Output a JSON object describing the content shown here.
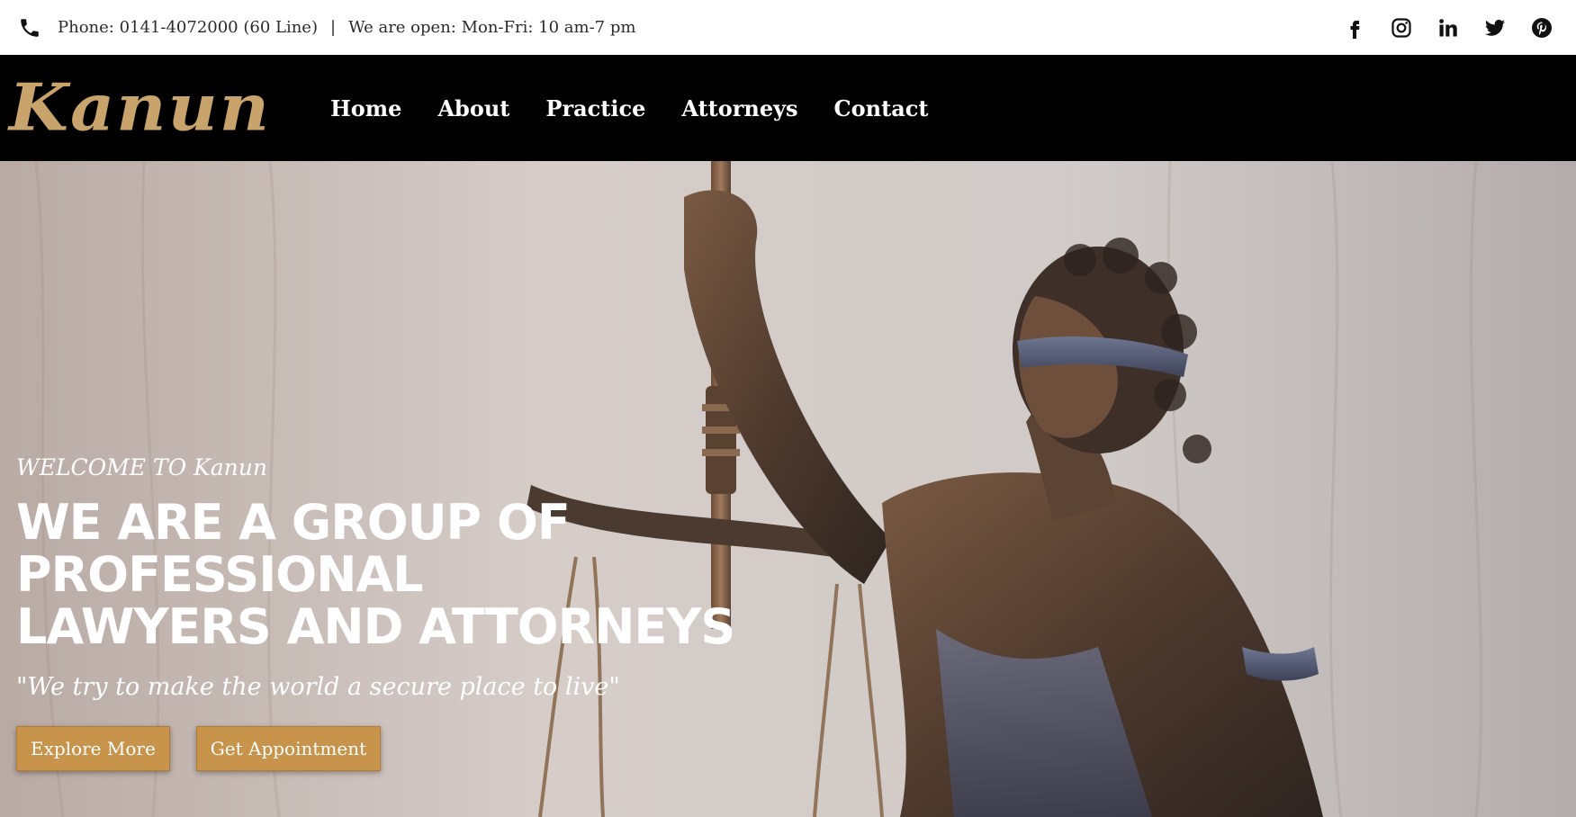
{
  "topbar": {
    "phone_text": "Phone: 0141-4072000 (60 Line)",
    "separator": "|",
    "hours_text": "We are open: Mon-Fri: 10 am-7 pm",
    "social_icons": [
      "facebook-icon",
      "instagram-icon",
      "linkedin-icon",
      "twitter-icon",
      "pinterest-icon"
    ]
  },
  "brand": {
    "logo_text": "Kanun",
    "logo_color": "#c8a36b"
  },
  "nav": {
    "items": [
      {
        "label": "Home"
      },
      {
        "label": "About"
      },
      {
        "label": "Practice"
      },
      {
        "label": "Attorneys"
      },
      {
        "label": "Contact"
      }
    ]
  },
  "hero": {
    "welcome": "WELCOME TO Kanun",
    "headline_line1": "WE ARE A GROUP OF PROFESSIONAL",
    "headline_line2": "LAWYERS AND ATTORNEYS",
    "tagline": "\"We try to make the world a secure place to live\"",
    "buttons": {
      "explore": "Explore More",
      "appointment": "Get Appointment"
    },
    "button_color": "#c8944b"
  }
}
